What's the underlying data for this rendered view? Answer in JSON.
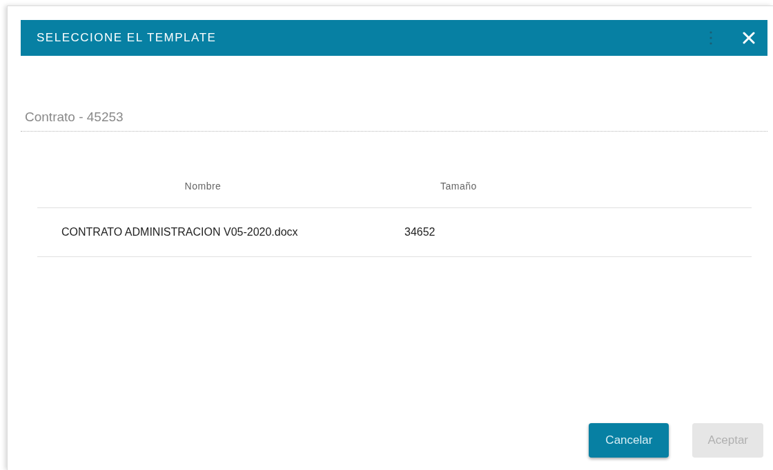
{
  "dialog": {
    "title": "SELECCIONE EL TEMPLATE",
    "contract_field": {
      "value": "Contrato - 45253"
    },
    "table": {
      "columns": [
        "Nombre",
        "Tamaño"
      ],
      "rows": [
        {
          "cells": [
            "CONTRATO ADMINISTRACION V05-2020.docx",
            "34652"
          ]
        }
      ]
    },
    "buttons": [
      {
        "label": "Cancelar",
        "disabled": false
      },
      {
        "label": "Aceptar",
        "disabled": true
      }
    ]
  }
}
